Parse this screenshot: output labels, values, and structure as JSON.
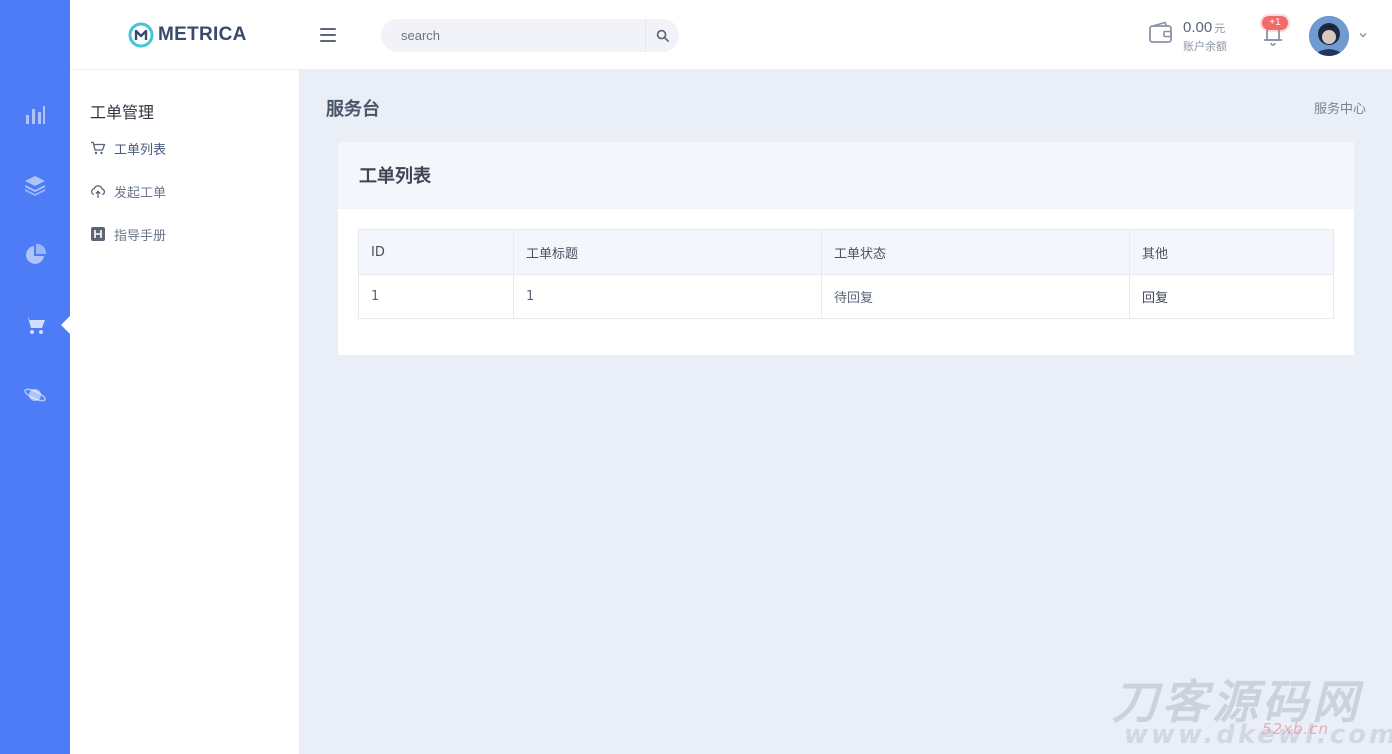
{
  "brand": {
    "name": "METRICA"
  },
  "search": {
    "placeholder": "search"
  },
  "account": {
    "amount": "0.00",
    "unit": "元",
    "label": "账户余额"
  },
  "notifications": {
    "badge": "+1"
  },
  "rail": {
    "items": [
      {
        "icon": "bar-chart-icon"
      },
      {
        "icon": "layers-icon"
      },
      {
        "icon": "pie-chart-icon"
      },
      {
        "icon": "cart-icon",
        "active": true
      },
      {
        "icon": "planet-icon"
      }
    ]
  },
  "subnav": {
    "title": "工单管理",
    "items": [
      {
        "label": "工单列表",
        "icon": "cart-icon",
        "active": true
      },
      {
        "label": "发起工单",
        "icon": "cloud-upload-icon"
      },
      {
        "label": "指导手册",
        "icon": "h-square-icon"
      }
    ]
  },
  "page": {
    "title": "服务台",
    "breadcrumb": "服务中心"
  },
  "card": {
    "title": "工单列表",
    "columns": [
      "ID",
      "工单标题",
      "工单状态",
      "其他"
    ],
    "rows": [
      [
        "1",
        "1",
        "待回复",
        "回复"
      ]
    ]
  },
  "watermark": {
    "main": "刀客源码网",
    "sub": "www.dkewl.com",
    "red": "52xb.cn"
  }
}
